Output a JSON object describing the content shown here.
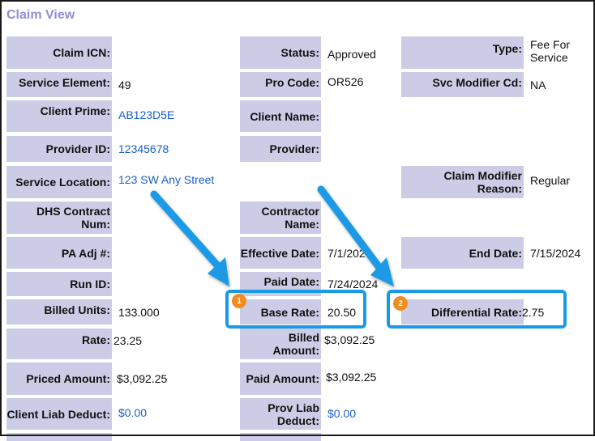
{
  "page": {
    "title": "Claim View"
  },
  "fields": {
    "claim_icn": {
      "label": "Claim ICN:",
      "value": ""
    },
    "status": {
      "label": "Status:",
      "value": "Approved"
    },
    "type": {
      "label": "Type:",
      "value": "Fee For Service"
    },
    "service_element": {
      "label": "Service Element:",
      "value": "49"
    },
    "pro_code": {
      "label": "Pro Code:",
      "value": "OR526"
    },
    "svc_modifier_cd": {
      "label": "Svc Modifier Cd:",
      "value": "NA"
    },
    "client_prime": {
      "label": "Client Prime:",
      "value": "AB123D5E"
    },
    "client_name": {
      "label": "Client Name:",
      "value": ""
    },
    "provider_id": {
      "label": "Provider ID:",
      "value": "12345678"
    },
    "provider": {
      "label": "Provider:",
      "value": ""
    },
    "service_location": {
      "label": "Service Location:",
      "value": "123 SW Any Street"
    },
    "claim_modifier_reason": {
      "label": "Claim Modifier Reason:",
      "value": "Regular"
    },
    "dhs_contract_num": {
      "label": "DHS Contract Num:",
      "value": ""
    },
    "contractor_name": {
      "label": "Contractor Name:",
      "value": ""
    },
    "pa_adj": {
      "label": "PA Adj #:",
      "value": ""
    },
    "effective_date": {
      "label": "Effective Date:",
      "value": "7/1/2024"
    },
    "end_date": {
      "label": "End Date:",
      "value": "7/15/2024"
    },
    "run_id": {
      "label": "Run ID:",
      "value": ""
    },
    "paid_date": {
      "label": "Paid Date:",
      "value": "7/24/2024"
    },
    "billed_units": {
      "label": "Billed Units:",
      "value": "133.000"
    },
    "base_rate": {
      "label": "Base Rate:",
      "value": "20.50"
    },
    "differential_rate": {
      "label": "Differential Rate:",
      "value": "2.75"
    },
    "rate": {
      "label": "Rate:",
      "value": "23.25"
    },
    "billed_amount": {
      "label": "Billed Amount:",
      "value": "$3,092.25"
    },
    "priced_amount": {
      "label": "Priced Amount:",
      "value": "$3,092.25"
    },
    "paid_amount": {
      "label": "Paid Amount:",
      "value": "$3,092.25"
    },
    "client_liab_deduct": {
      "label": "Client Liab Deduct:",
      "value": "$0.00"
    },
    "prov_liab_deduct": {
      "label": "Prov Liab Deduct:",
      "value": "$0.00"
    }
  },
  "annotations": {
    "badge_1": "1",
    "badge_2": "2"
  },
  "colors": {
    "label_bg": "#cccce6",
    "title": "#8e8ed6",
    "link": "#1a5fc8",
    "highlight": "#1a9ae6",
    "badge": "#f28c1e"
  }
}
